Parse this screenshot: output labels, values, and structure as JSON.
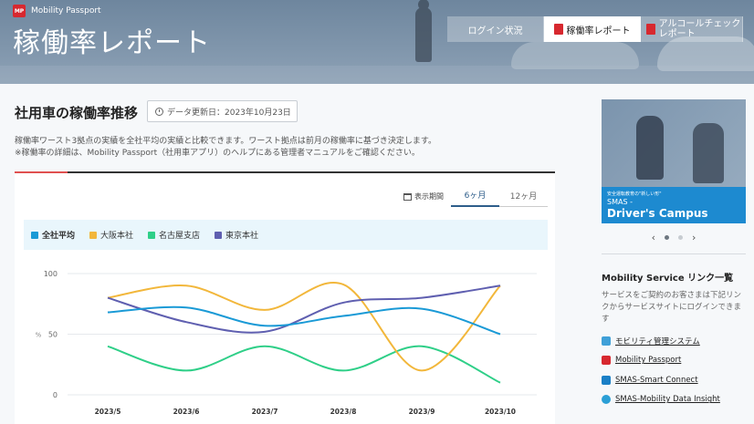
{
  "header": {
    "brand": "Mobility Passport",
    "title": "稼働率レポート",
    "nav": {
      "login": "ログイン状況",
      "rate": "稼働率レポート",
      "alcohol_line1": "アルコールチェック",
      "alcohol_line2": "レポート"
    }
  },
  "main": {
    "section_title": "社用車の稼働率推移",
    "update_label": "データ更新日：2023年10月23日",
    "desc_line1": "稼働率ワースト3拠点の実績を全社平均の実績と比較できます。ワースト拠点は前月の稼働率に基づき決定します。",
    "desc_line2": "※稼働率の詳細は、Mobility Passport（社用車アプリ）のヘルプにある管理者マニュアルをご確認ください。",
    "period_label": "表示期間",
    "tab_6": "6ヶ月",
    "tab_12": "12ヶ月"
  },
  "chart_data": {
    "type": "line",
    "categories": [
      "2023/5",
      "2023/6",
      "2023/7",
      "2023/8",
      "2023/9",
      "2023/10"
    ],
    "ylabel": "%",
    "ylim": [
      0,
      100
    ],
    "yticks": [
      "0",
      "50",
      "100"
    ],
    "series": [
      {
        "name": "全社平均",
        "color": "#1a9ad6",
        "values": [
          68,
          72,
          57,
          65,
          71,
          50
        ]
      },
      {
        "name": "大阪本社",
        "color": "#f2b73b",
        "values": [
          80,
          90,
          70,
          91,
          20,
          90
        ]
      },
      {
        "name": "名古屋支店",
        "color": "#2fcf88",
        "values": [
          40,
          20,
          40,
          20,
          40,
          10
        ]
      },
      {
        "name": "東京本社",
        "color": "#5f5fb0",
        "values": [
          80,
          60,
          52,
          76,
          80,
          90
        ]
      }
    ]
  },
  "side": {
    "banner_small": "安全運転教育の\"新しい形\"",
    "banner_smas": "SMAS -",
    "banner_campus": "Driver's Campus",
    "prev": "‹",
    "next": "›",
    "links_title": "Mobility Service リンク一覧",
    "links_desc": "サービスをご契約のお客さまは下記リンクからサービスサイトにログインできます",
    "links": [
      {
        "label": "モビリティ管理システム",
        "color": "#3fa0d8"
      },
      {
        "label": "Mobility Passport",
        "color": "#d7282f"
      },
      {
        "label": "SMAS-Smart Connect",
        "color": "#1a7fc6"
      },
      {
        "label": "SMAS-Mobility Data Insight",
        "color": "#2b9fd6"
      }
    ]
  }
}
